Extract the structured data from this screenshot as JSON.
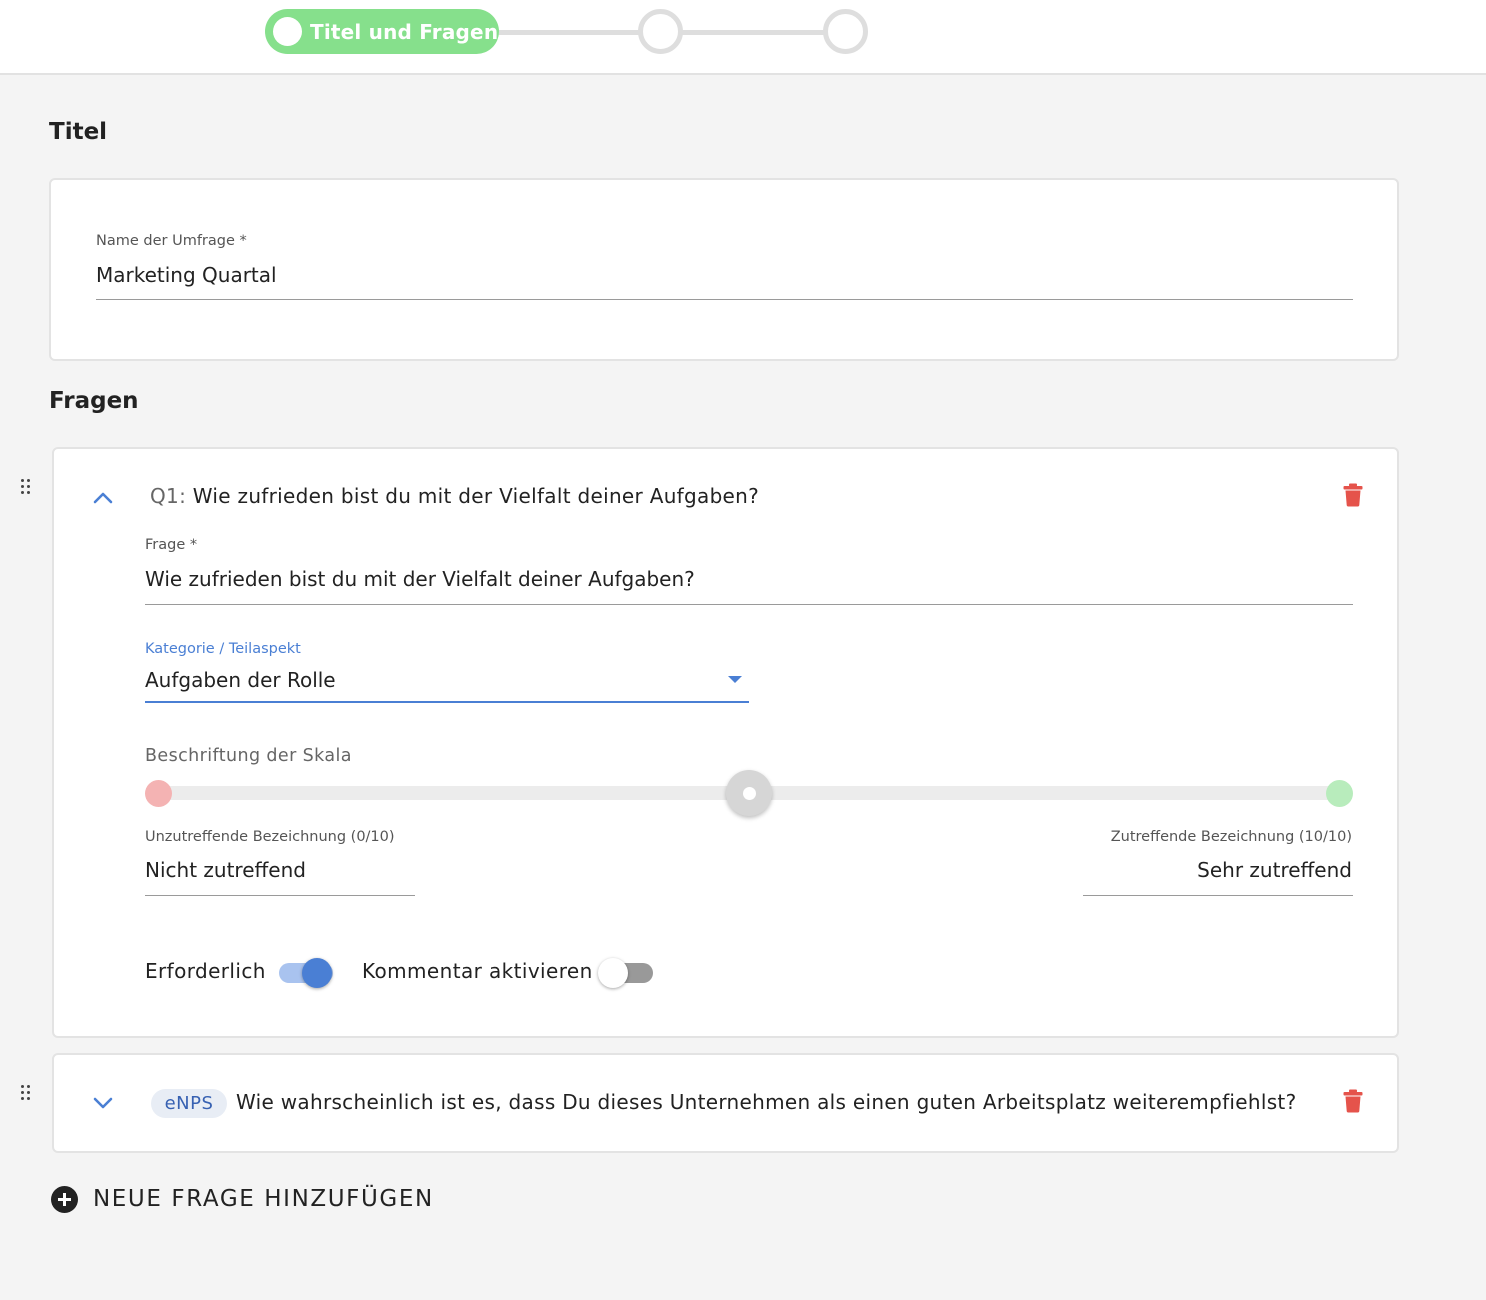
{
  "stepper": {
    "steps": [
      {
        "label": "Titel und Fragen",
        "state": "active"
      },
      {
        "label": "",
        "state": "pending"
      },
      {
        "label": "",
        "state": "pending"
      }
    ],
    "active_color": "#86e08c",
    "inactive_color": "#dedede"
  },
  "title_section": {
    "heading": "Titel",
    "survey_name_label": "Name der Umfrage *",
    "survey_name_value": "Marketing Quartal"
  },
  "questions_section": {
    "heading": "Fragen",
    "questions": [
      {
        "prefix": "Q1:",
        "title": "Wie zufrieden bist du mit der Vielfalt deiner Aufgaben?",
        "expanded": true,
        "question_label": "Frage *",
        "question_value": "Wie zufrieden bist du mit der Vielfalt deiner Aufgaben?",
        "category_label": "Kategorie / Teilaspekt",
        "category_value": "Aufgaben der Rolle",
        "scale_label": "Beschriftung der Skala",
        "scale_position": 0.5,
        "scale_low_color": "#f4b3b3",
        "scale_high_color": "#b8ecbc",
        "low_label": "Unzutreffende Bezeichnung (0/10)",
        "low_value": "Nicht zutreffend",
        "high_label": "Zutreffende Bezeichnung (10/10)",
        "high_value": "Sehr zutreffend",
        "required_label": "Erforderlich",
        "required_on": true,
        "comment_label": "Kommentar aktivieren",
        "comment_on": false
      },
      {
        "badge": "eNPS",
        "title": "Wie wahrscheinlich ist es, dass Du dieses Unternehmen als einen guten Arbeitsplatz weiterempfiehlst?",
        "expanded": false
      }
    ],
    "add_button_label": "NEUE FRAGE HINZUFÜGEN"
  },
  "colors": {
    "accent": "#4a7fd4",
    "delete": "#e5534b",
    "background": "#f4f4f4"
  },
  "icons": [
    "drag-handle-icon",
    "chevron-up-icon",
    "chevron-down-icon",
    "trash-icon",
    "add-circle-icon",
    "dropdown-arrow-icon"
  ]
}
